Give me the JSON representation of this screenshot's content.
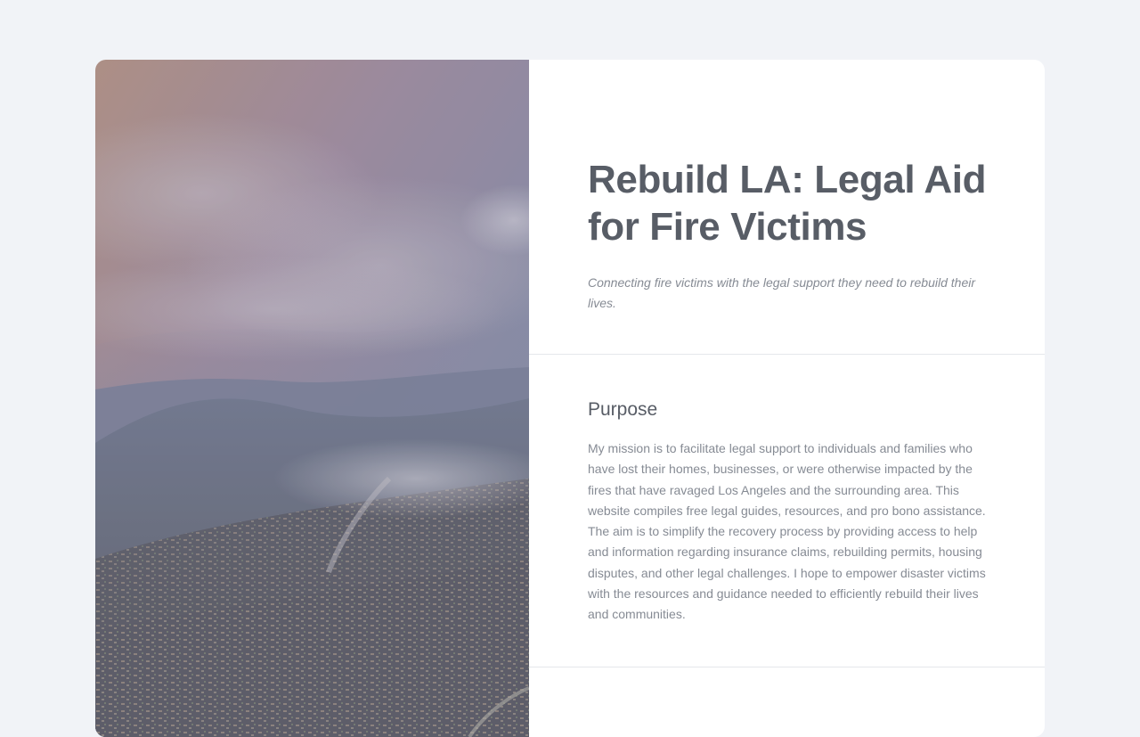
{
  "hero": {
    "image_description_icon": "fire-smoke-landscape-image"
  },
  "intro": {
    "title": "Rebuild LA: Legal Aid for Fire Victims",
    "subtitle": "Connecting fire victims with the legal support they need to rebuild their lives."
  },
  "purpose": {
    "heading": "Purpose",
    "body": "My mission is to facilitate legal support to individuals and families who have lost their homes, businesses, or were otherwise impacted by the fires that have ravaged Los Angeles and the surrounding area. This website compiles free legal guides, resources, and pro bono assistance. The aim is to simplify the recovery process by providing access to help and information regarding insurance claims, rebuilding permits, housing disputes, and other legal challenges. I hope to empower disaster victims with the resources and guidance needed to efficiently rebuild their lives and communities."
  },
  "colors": {
    "page_background": "#f1f3f7",
    "card_background": "#ffffff",
    "title_text": "#585d66",
    "muted_text": "#868b94",
    "divider": "#e5e7eb"
  }
}
